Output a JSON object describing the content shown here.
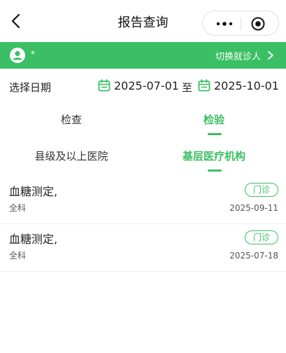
{
  "navbar": {
    "title": "报告查询",
    "back_icon": "chevron-left-icon",
    "more_icon": "more-dots-icon",
    "target_icon": "target-icon"
  },
  "patient_bar": {
    "name_masked": "*",
    "switch_label": "切换就诊人",
    "background": "#3bbf64"
  },
  "date_filter": {
    "label": "选择日期",
    "start": "2025-07-01",
    "separator": "至",
    "end": "2025-10-01"
  },
  "tabs_type": [
    {
      "label": "检查",
      "active": false
    },
    {
      "label": "检验",
      "active": true
    }
  ],
  "tabs_institution": [
    {
      "label": "县级及以上医院",
      "active": false
    },
    {
      "label": "基层医疗机构",
      "active": true
    }
  ],
  "reports": [
    {
      "title": "血糖测定,",
      "dept": "全科",
      "badge": "门诊",
      "date": "2025-09-11"
    },
    {
      "title": "血糖测定,",
      "dept": "全科",
      "badge": "门诊",
      "date": "2025-07-18"
    }
  ]
}
